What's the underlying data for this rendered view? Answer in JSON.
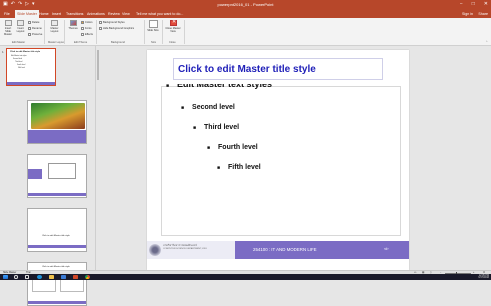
{
  "app": {
    "document_title": "powerpnt2016_01 - PowerPoint",
    "window_buttons": [
      "−",
      "□",
      "✕"
    ],
    "accent_color": "#b7472a"
  },
  "tabs": [
    {
      "label": "File"
    },
    {
      "label": "Slide Master",
      "active": true
    },
    {
      "label": "Home"
    },
    {
      "label": "Insert"
    },
    {
      "label": "Transitions"
    },
    {
      "label": "Animations"
    },
    {
      "label": "Review"
    },
    {
      "label": "View"
    },
    {
      "label": "Tell me what you want to do..."
    }
  ],
  "account": {
    "signin": "Sign in",
    "share": "Share"
  },
  "ribbon": {
    "edit_master": {
      "insert_slide_master": "Insert Slide Master",
      "insert_layout": "Insert Layout",
      "delete": "Delete",
      "rename": "Rename",
      "preserve": "Preserve",
      "label": "Edit Master"
    },
    "master_layout": {
      "master_layout_btn": "Master Layout",
      "label": "Master Layout"
    },
    "edit_theme": {
      "themes": "Themes",
      "colors": "Colors",
      "fonts": "Fonts",
      "effects": "Effects",
      "label": "Edit Theme"
    },
    "background": {
      "background_styles": "Background Styles",
      "hide_background_graphics": "Hide Background Graphics",
      "label": "Background"
    },
    "size": {
      "slide_size": "Slide Size",
      "label": "Size"
    },
    "close": {
      "close_master_view": "Close Master View",
      "label": "Close"
    }
  },
  "thumbnails": [
    {
      "num": "1",
      "title": "Click to edit Master title style",
      "bullets": [
        "Edit Master text styles",
        "Second level",
        "Third level",
        "Fourth level",
        "Fifth level"
      ],
      "selected": true
    },
    {
      "num": "",
      "title": "Click to edit Master title style"
    },
    {
      "num": "",
      "title": "Click to edit Master title style"
    },
    {
      "num": "",
      "title": "Click to edit Master title style"
    },
    {
      "num": "",
      "title": "Click to edit Master title style"
    }
  ],
  "slide": {
    "title": "Click to edit Master title style",
    "levels": [
      "Edit Master text styles",
      "Second level",
      "Third level",
      "Fourth level",
      "Fifth level"
    ],
    "footer_th": "ภาควิชาวิทยาการคอมพิวเตอร์",
    "footer_en": "COMPUTER SCIENCE DEPARTMENT, KKU",
    "footer_course": "254100 : IT AND MODERN LIFE",
    "footer_number": "‹#›",
    "title_color": "#1f1fb8",
    "band_color": "#7b6cc4"
  },
  "status": {
    "view": "Slide Master",
    "language": "Thai",
    "zoom": "+"
  },
  "taskbar": {
    "time": "12:05 PM",
    "date": "6/17/2016"
  }
}
